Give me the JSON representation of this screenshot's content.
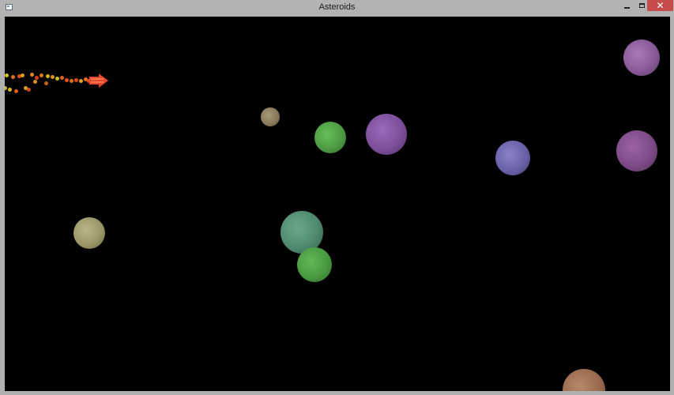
{
  "window": {
    "title": "Asteroids",
    "icon": "app-icon",
    "controls": [
      "minimize-icon",
      "maximize-icon",
      "close-icon"
    ],
    "close_glyph": "✕"
  },
  "game": {
    "background_color": "#000000",
    "ship": {
      "icon": "ship-arrow-icon",
      "color": "#e8452a"
    },
    "asteroid_colors": [
      "#8a7a5c",
      "#4e9a44",
      "#7c4f9a",
      "#6a62a8",
      "#7e4a86",
      "#9a9868",
      "#4f8a70",
      "#4a9a40",
      "#9a6a4e",
      "#8a5a98"
    ]
  }
}
